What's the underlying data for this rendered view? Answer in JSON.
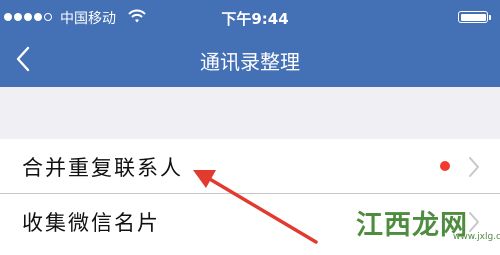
{
  "status_bar": {
    "carrier": "中国移动",
    "time": "下午9:44",
    "signal_bars_filled": 4,
    "signal_bars_total": 5,
    "battery_level": 1.0,
    "icons": [
      "signal-icon",
      "wifi-icon",
      "battery-icon"
    ]
  },
  "nav": {
    "title": "通讯录整理",
    "back_icon": "chevron-left-icon"
  },
  "list": {
    "items": [
      {
        "label": "合并重复联系人",
        "has_badge": true,
        "badge_color": "#f03a2f",
        "icon": "chevron-right-icon"
      },
      {
        "label": "收集微信名片",
        "has_badge": false,
        "icon": "chevron-right-icon"
      }
    ]
  },
  "annotation": {
    "arrow_color": "#e23a2e",
    "icon": "red-arrow-annotation"
  },
  "watermark": {
    "text": "江西龙网",
    "url": "www.jxlg.com",
    "color": "#4e8c3f"
  },
  "colors": {
    "nav_background": "#4470b5",
    "section_background": "#efeff4",
    "separator": "#c8c7cc"
  }
}
